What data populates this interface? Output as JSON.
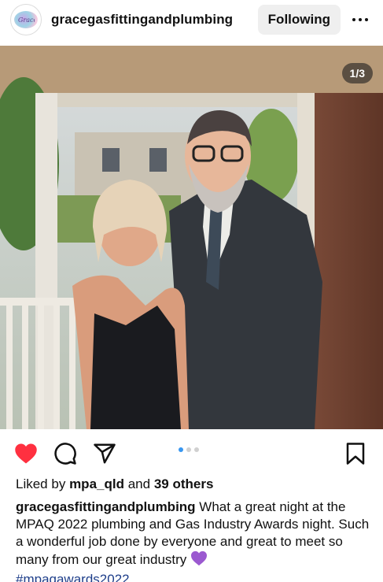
{
  "header": {
    "username": "gracegasfittingandplumbing",
    "follow_label": "Following"
  },
  "photo": {
    "counter": "1/3"
  },
  "carousel": {
    "count": 3,
    "active_index": 0
  },
  "likes": {
    "prefix": "Liked by",
    "user": "mpa_qld",
    "middle": "and",
    "others": "39 others"
  },
  "caption": {
    "username": "gracegasfittingandplumbing",
    "text": "What a great night at the MPAQ 2022 plumbing and Gas Industry Awards night. Such a wonderful job done by everyone and great to meet so many from our great industry",
    "emoji": "purple-heart",
    "hashtag": "#mpaqawards2022"
  },
  "colors": {
    "like_red": "#ff3040",
    "dot_active": "#3897f0",
    "hashtag": "#1e3e8a"
  },
  "icons": [
    "more-icon",
    "heart-icon",
    "comment-icon",
    "share-icon",
    "bookmark-icon"
  ]
}
